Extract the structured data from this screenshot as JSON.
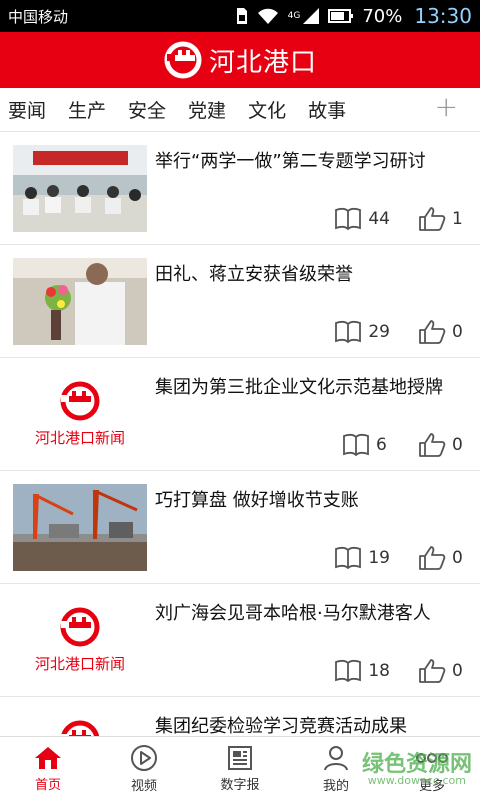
{
  "status_bar": {
    "carrier": "中国移动",
    "battery": "70%",
    "time": "13:30",
    "network": "4G"
  },
  "app_bar": {
    "title": "河北港口"
  },
  "tabs": [
    "要闻",
    "生产",
    "安全",
    "党建",
    "文化",
    "故事"
  ],
  "tab_add_label": "+",
  "brand_placeholder": "河北港口新闻",
  "articles": [
    {
      "title": "举行“两学一做”第二专题学习研讨",
      "reads": "44",
      "likes": "1",
      "thumb": "meeting-photo"
    },
    {
      "title": "田礼、蒋立安获省级荣誉",
      "reads": "29",
      "likes": "0",
      "thumb": "award-photo"
    },
    {
      "title": "集团为第三批企业文化示范基地授牌",
      "reads": "6",
      "likes": "0",
      "thumb": "brand-logo"
    },
    {
      "title": "巧打算盘 做好增收节支账",
      "reads": "19",
      "likes": "0",
      "thumb": "port-photo"
    },
    {
      "title": "刘广海会见哥本哈根·马尔默港客人",
      "reads": "18",
      "likes": "0",
      "thumb": "brand-logo"
    },
    {
      "title": "集团纪委检验学习竞赛活动成果",
      "reads": "",
      "likes": "",
      "thumb": "brand-logo"
    }
  ],
  "bottom_nav": [
    {
      "label": "首页",
      "icon": "home-icon",
      "active": true
    },
    {
      "label": "视频",
      "icon": "play-icon",
      "active": false
    },
    {
      "label": "数字报",
      "icon": "newspaper-icon",
      "active": false
    },
    {
      "label": "我的",
      "icon": "user-icon",
      "active": false
    },
    {
      "label": "更多",
      "icon": "more-icon",
      "active": false
    }
  ],
  "watermark": {
    "text": "绿色资源网",
    "sub": "www.downcc.com"
  },
  "colors": {
    "brand_red": "#e60012",
    "time_blue": "#8fd4ff"
  }
}
